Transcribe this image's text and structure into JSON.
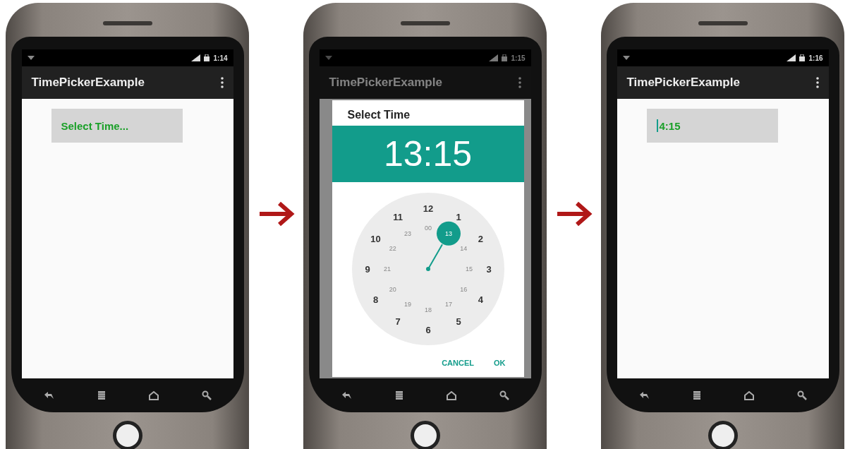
{
  "phones": [
    {
      "kind": "app",
      "status_time": "1:14",
      "app_title": "TimePickerExample",
      "field": {
        "value": "Select Time...",
        "focused": false
      }
    },
    {
      "kind": "dialog",
      "status_time": "1:15",
      "app_title": "TimePickerExample",
      "dialog": {
        "title": "Select Time",
        "time": "13:15",
        "outer": [
          "12",
          "1",
          "2",
          "3",
          "4",
          "5",
          "6",
          "7",
          "8",
          "9",
          "10",
          "11"
        ],
        "inner": [
          {
            "label": "00",
            "selected": false
          },
          {
            "label": "13",
            "selected": true
          },
          {
            "label": "14",
            "selected": false
          },
          {
            "label": "15",
            "selected": false
          },
          {
            "label": "16",
            "selected": false
          },
          {
            "label": "17",
            "selected": false
          },
          {
            "label": "18",
            "selected": false
          },
          {
            "label": "19",
            "selected": false
          },
          {
            "label": "20",
            "selected": false
          },
          {
            "label": "21",
            "selected": false
          },
          {
            "label": "22",
            "selected": false
          },
          {
            "label": "23",
            "selected": false
          }
        ],
        "buttons": [
          "CANCEL",
          "OK"
        ]
      }
    },
    {
      "kind": "app",
      "status_time": "1:16",
      "app_title": "TimePickerExample",
      "field": {
        "value": "4:15",
        "focused": true
      }
    }
  ]
}
